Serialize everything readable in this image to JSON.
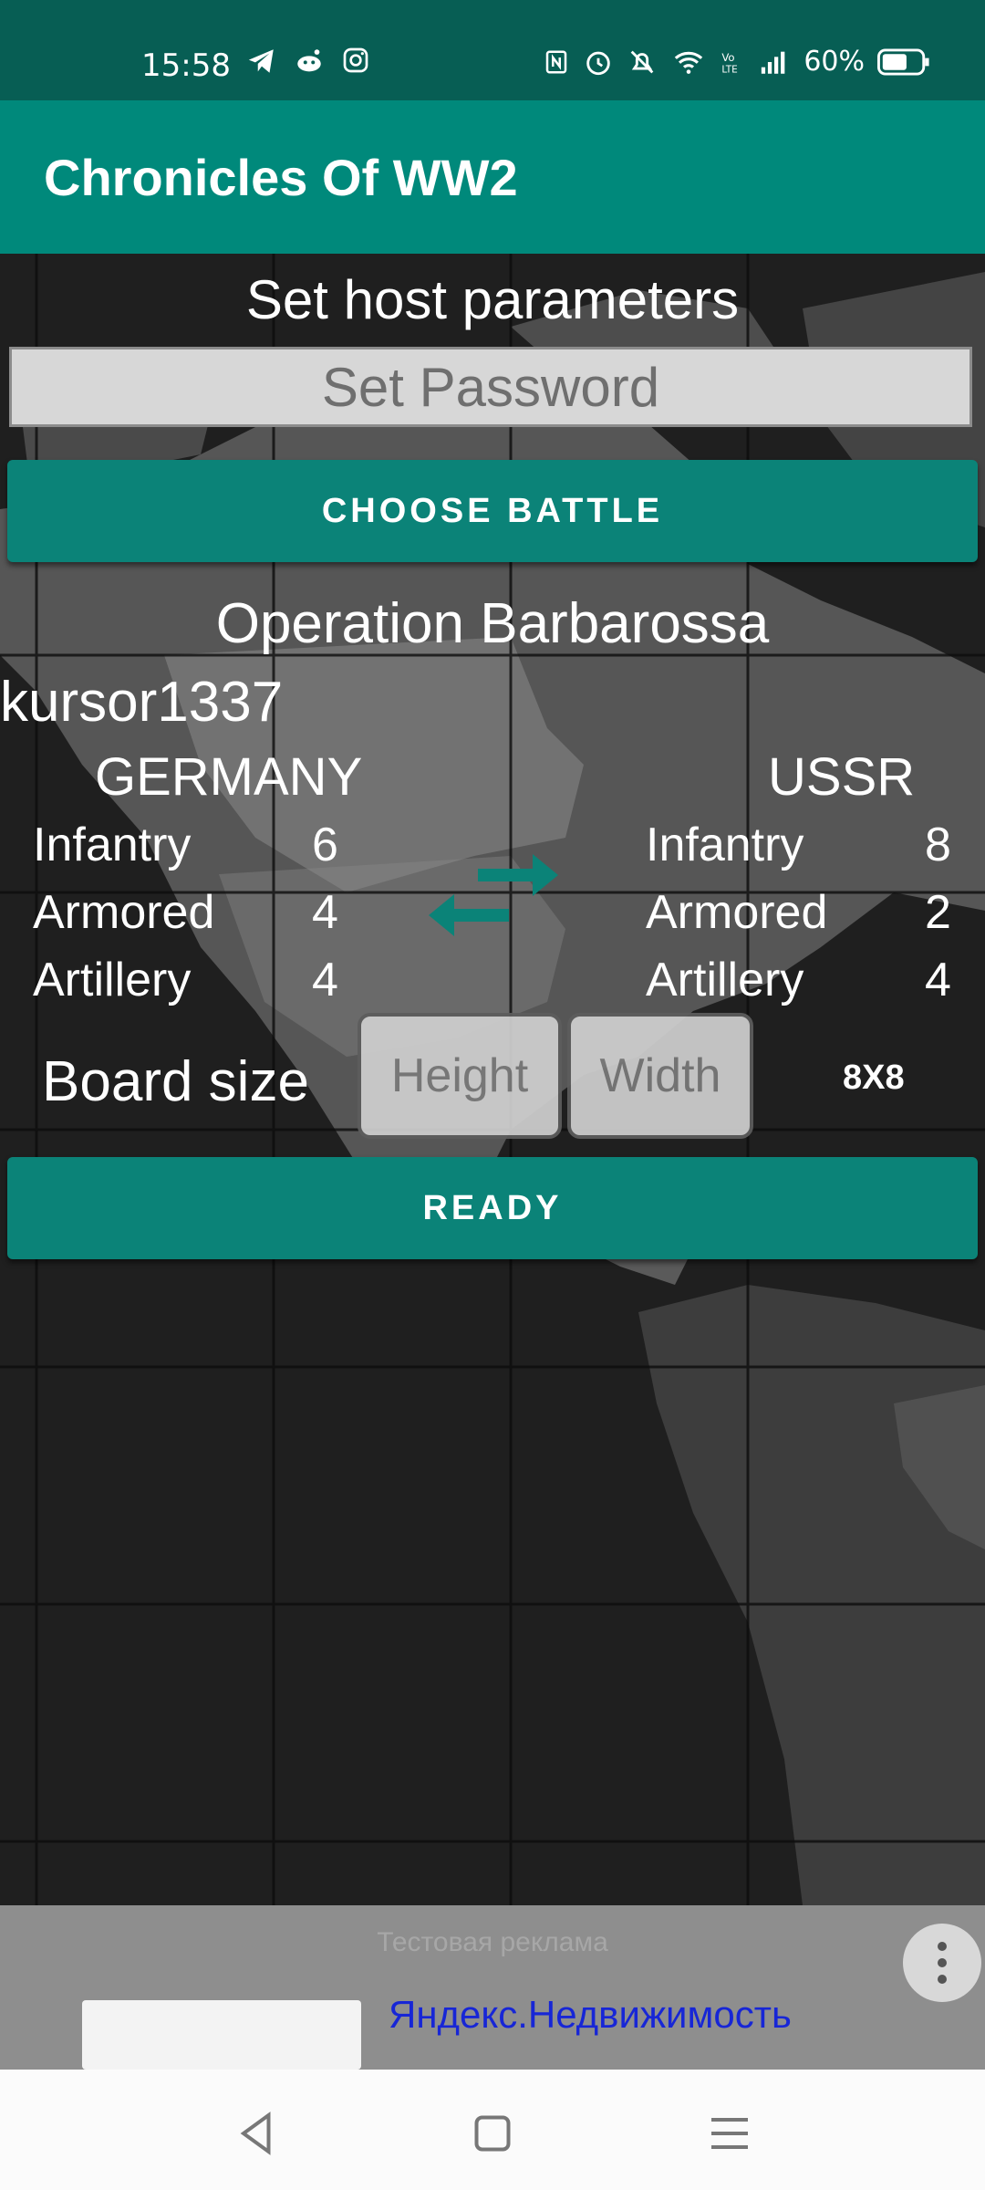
{
  "status_bar": {
    "time": "15:58",
    "battery": "60%",
    "left_icons": [
      "telegram-icon",
      "reddit-icon",
      "instagram-icon"
    ],
    "right_icons": [
      "nfc-icon",
      "alarm-icon",
      "mute-icon",
      "wifi-icon",
      "volte-icon",
      "signal-icon",
      "battery-icon"
    ]
  },
  "app_bar": {
    "title": "Chronicles Of WW2",
    "color": "#00897b"
  },
  "host": {
    "title": "Set host parameters",
    "password_placeholder": "Set Password",
    "choose_battle_label": "CHOOSE BATTLE",
    "battle_name": "Operation Barbarossa",
    "player_name": "kursor1337"
  },
  "sides": {
    "left": {
      "name": "GERMANY",
      "units": [
        {
          "label": "Infantry",
          "count": "6"
        },
        {
          "label": "Armored",
          "count": "4"
        },
        {
          "label": "Artillery",
          "count": "4"
        }
      ]
    },
    "right": {
      "name": "USSR",
      "units": [
        {
          "label": "Infantry",
          "count": "8"
        },
        {
          "label": "Armored",
          "count": "2"
        },
        {
          "label": "Artillery",
          "count": "4"
        }
      ]
    },
    "swap_icon": "swap-arrows-icon"
  },
  "board": {
    "label": "Board size",
    "height_placeholder": "Height",
    "width_placeholder": "Width",
    "value": "8X8"
  },
  "ready_label": "READY",
  "ad": {
    "label": "Тестовая реклама",
    "link_text": "Яндекс.Недвижимость"
  },
  "accent_color": "#0b8378"
}
